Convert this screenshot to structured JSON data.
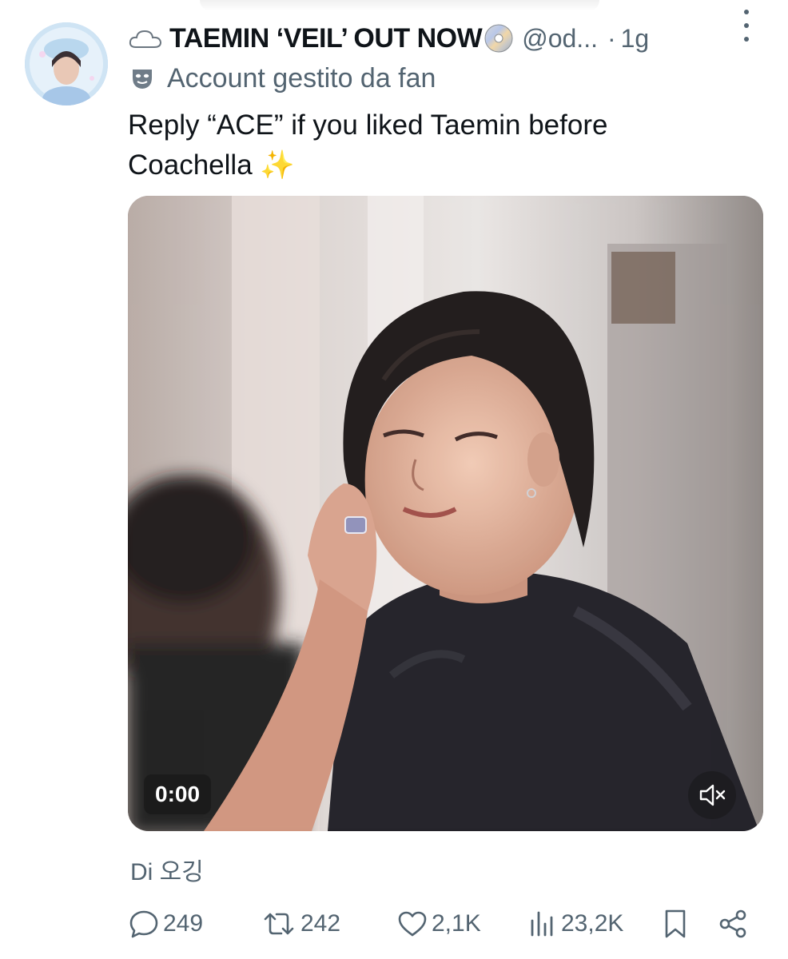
{
  "author": {
    "display_name": "TAEMIN ‘VEIL’ OUT NOW",
    "handle": "@od...",
    "dot": "·",
    "time": "1g",
    "badge": "Account gestito da fan",
    "icons": [
      "cloud-icon",
      "cd-icon",
      "mask-icon",
      "more-icon"
    ]
  },
  "tweet": {
    "text": "Reply “ACE” if you liked Taemin before Coachella ✨"
  },
  "media": {
    "time": "0:00",
    "mute_icon": "speaker-muted-icon"
  },
  "attribution": "Di 오깅",
  "actions": {
    "replies": "249",
    "retweets": "242",
    "likes": "2,1K",
    "views": "23,2K"
  },
  "colors": {
    "text": "#0f1419",
    "secondary": "#536471"
  }
}
